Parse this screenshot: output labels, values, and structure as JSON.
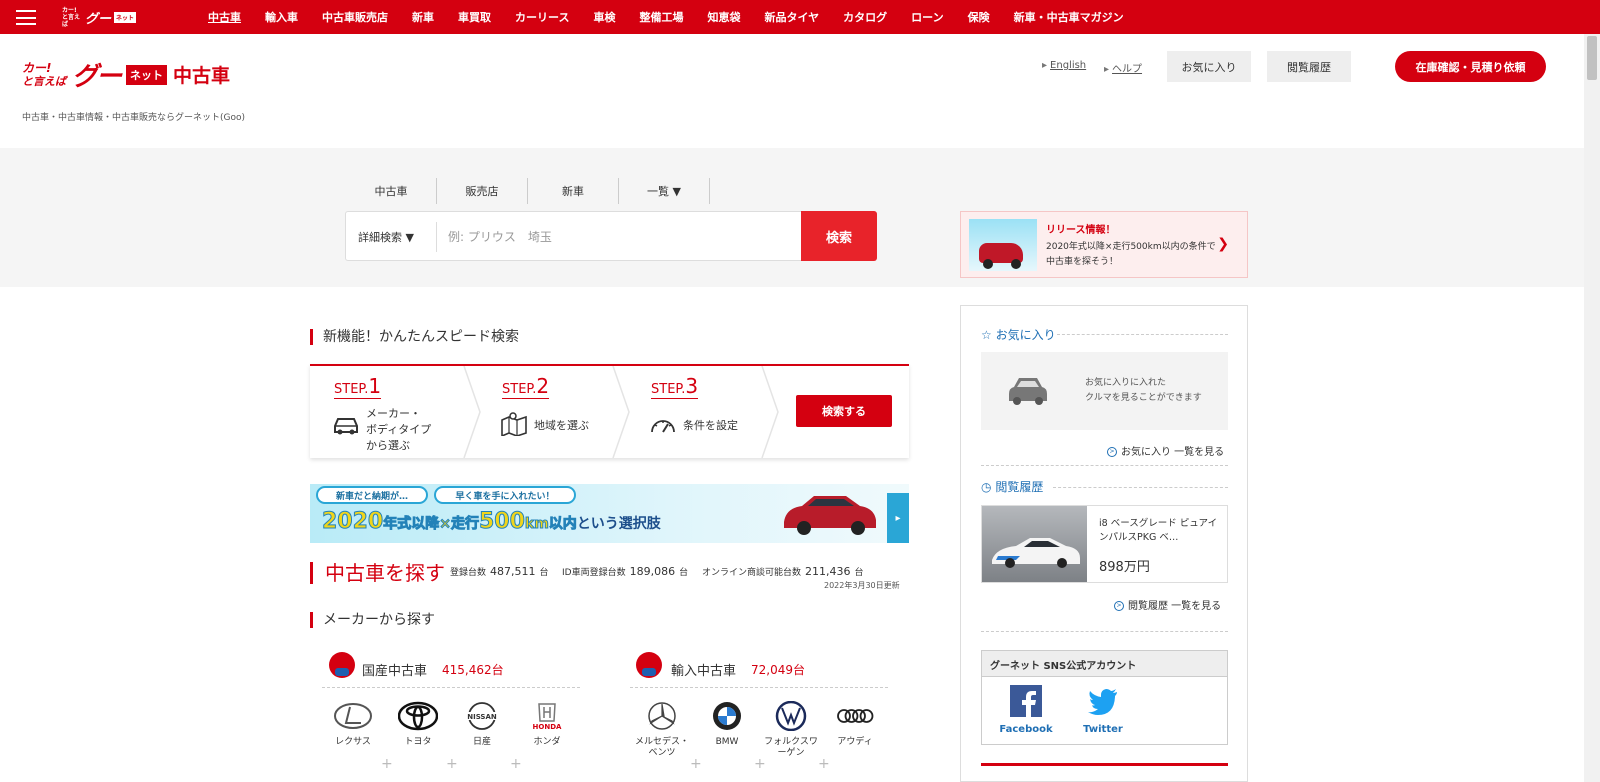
{
  "topnav": {
    "items": [
      "中古車",
      "輸入車",
      "中古車販売店",
      "新車",
      "車買取",
      "カーリース",
      "車検",
      "整備工場",
      "知恵袋",
      "新品タイヤ",
      "カタログ",
      "ローン",
      "保険",
      "新車・中古車マガジン"
    ],
    "mini_logo": {
      "small": "カー!と言えば",
      "goo": "グー",
      "net": "ネット"
    }
  },
  "header": {
    "logo_small_1": "カー!",
    "logo_small_2": "と言えば",
    "logo_goo": "グー",
    "logo_net": "ネット",
    "logo_used": "中古車",
    "tagline": "中古車・中古車情報・中古車販売ならグーネット(Goo)",
    "english": "English",
    "help": "ヘルプ",
    "favorites": "お気に入り",
    "history": "閲覧履歴",
    "stock_button": "在庫確認・見積り依頼"
  },
  "search": {
    "tabs": [
      "中古車",
      "販売店",
      "新車",
      "一覧 ▼"
    ],
    "detail": "詳細検索 ▼",
    "placeholder": "例: プリウス　埼玉",
    "button": "検索"
  },
  "release": {
    "title": "リリース情報！",
    "text": "2020年式以降×走行500km以内の条件で中古車を探そう！"
  },
  "speed_search": {
    "title": "新機能！かんたんスピード検索",
    "step_word": "STEP.",
    "steps": [
      {
        "num": "1",
        "text_lines": [
          "メーカー・",
          "ボディタイプ",
          "から選ぶ"
        ]
      },
      {
        "num": "2",
        "text_lines": [
          "地域を選ぶ"
        ]
      },
      {
        "num": "3",
        "text_lines": [
          "条件を設定"
        ]
      }
    ],
    "button": "検索する"
  },
  "banner": {
    "bubble1": "新車だと納期が…",
    "bubble2": "早く車を手に入れたい！",
    "main_a": "2020",
    "main_b": "年式以降×走行",
    "main_c": "500",
    "main_d": "km以内",
    "main_e": "という選択肢"
  },
  "used_search": {
    "title": "中古車を探す",
    "stats": [
      {
        "label": "登録台数",
        "value": "487,511",
        "unit": "台"
      },
      {
        "label": "ID車両登録台数",
        "value": "189,086",
        "unit": "台"
      },
      {
        "label": "オンライン商談可能台数",
        "value": "211,436",
        "unit": "台"
      }
    ],
    "updated": "2022年3月30日更新",
    "maker_title": "メーカーから探す",
    "domestic": {
      "title": "国産中古車",
      "count": "415,462台"
    },
    "import": {
      "title": "輸入中古車",
      "count": "72,049台"
    },
    "domestic_brands": [
      {
        "name": "レクサス",
        "icon": "lexus-logo"
      },
      {
        "name": "トヨタ",
        "icon": "toyota-logo"
      },
      {
        "name": "日産",
        "icon": "nissan-logo"
      },
      {
        "name": "ホンダ",
        "icon": "honda-logo"
      }
    ],
    "import_brands": [
      {
        "name": "メルセデス・ベンツ",
        "icon": "mercedes-logo"
      },
      {
        "name": "BMW",
        "icon": "bmw-logo"
      },
      {
        "name": "フォルクスワーゲン",
        "icon": "vw-logo"
      },
      {
        "name": "アウディ",
        "icon": "audi-logo"
      }
    ],
    "honda_text": "HONDA",
    "nissan_text": "NISSAN"
  },
  "sidebar": {
    "fav_title": "お気に入り",
    "fav_msg_1": "お気に入りに入れた",
    "fav_msg_2": "クルマを見ることができます",
    "fav_more": "お気に入り 一覧を見る",
    "hist_title": "閲覧履歴",
    "hist_name": "i8 ベースグレード ピュアインパルスPKG ベ…",
    "hist_price": "898万円",
    "hist_more": "閲覧履歴 一覧を見る",
    "sns_title": "グーネット SNS公式アカウント",
    "facebook": "Facebook",
    "twitter": "Twitter"
  },
  "colors": {
    "brand_red": "#d40010",
    "link_blue": "#1f6fb4"
  }
}
